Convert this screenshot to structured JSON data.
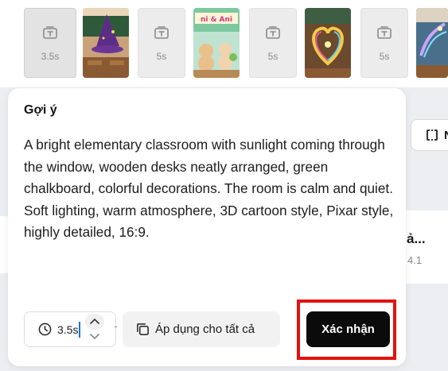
{
  "timeline": {
    "clips": [
      {
        "kind": "text",
        "duration": "3.5s",
        "selected": true
      },
      {
        "kind": "image",
        "scene": "witch-hat-classroom"
      },
      {
        "kind": "text",
        "duration": "5s"
      },
      {
        "kind": "image",
        "scene": "animals-classroom",
        "sign_text": "ni & Ani"
      },
      {
        "kind": "text",
        "duration": "5s"
      },
      {
        "kind": "image",
        "scene": "heart-sparkle-classroom"
      },
      {
        "kind": "text",
        "duration": "5s"
      },
      {
        "kind": "image",
        "scene": "magic-classroom"
      }
    ]
  },
  "background": {
    "frame_button_label": "N",
    "row_title": "ả...",
    "row_sub": "4.1"
  },
  "popup": {
    "title": "Gợi ý",
    "prompt": "A bright elementary classroom with sunlight coming through the window, wooden desks neatly arranged, green chalkboard, colorful decorations. The room is calm and quiet. Soft lighting, warm atmosphere, 3D cartoon style, Pixar style, highly detailed, 16:9.",
    "duration_value": "3.5s",
    "separator": "-",
    "apply_all_label": "Áp dụng cho tất cả",
    "confirm_label": "Xác nhận"
  },
  "icons": {
    "text_clip": "text-box-icon",
    "duration": "clock-icon",
    "stepper_up": "chevron-up-icon",
    "stepper_down": "chevron-down-icon",
    "apply_all": "copy-icon",
    "frame": "frame-icon"
  },
  "colors": {
    "highlight": "#e3110f",
    "confirm_bg": "#0b0b0b",
    "caret": "#1a73e8"
  }
}
